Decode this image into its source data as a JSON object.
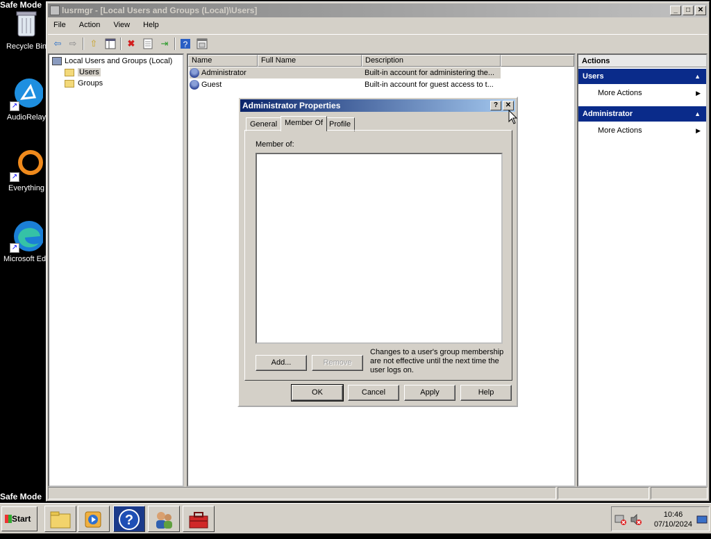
{
  "desktop": {
    "safe_mode_top": "Safe Mode",
    "safe_mode_bottom": "Safe Mode",
    "icons": [
      {
        "label": "Recycle Bin",
        "icon": "recycle-bin-icon"
      },
      {
        "label": "AudioRelay",
        "icon": "audiorelay-icon"
      },
      {
        "label": "Everything",
        "icon": "everything-icon"
      },
      {
        "label": "Microsoft Edge",
        "icon": "edge-icon"
      }
    ]
  },
  "window": {
    "title": "lusrmgr - [Local Users and Groups (Local)\\Users]",
    "controls": {
      "minimize": "_",
      "maximize": "□",
      "close": "✕"
    },
    "menu": [
      "File",
      "Action",
      "View",
      "Help"
    ],
    "toolbar_icons": [
      "back-icon",
      "forward-icon",
      "up-folder-icon",
      "show-hide-tree-icon",
      "delete-icon",
      "properties-icon",
      "export-list-icon",
      "help-icon",
      "console-icon"
    ]
  },
  "tree": {
    "root": "Local Users and Groups (Local)",
    "children": [
      {
        "label": "Users",
        "selected": true
      },
      {
        "label": "Groups",
        "selected": false
      }
    ]
  },
  "list": {
    "columns": [
      "Name",
      "Full Name",
      "Description"
    ],
    "rows": [
      {
        "name": "Administrator",
        "full_name": "",
        "description": "Built-in account for administering the..."
      },
      {
        "name": "Guest",
        "full_name": "",
        "description": "Built-in account for guest access to t..."
      }
    ]
  },
  "actions": {
    "title": "Actions",
    "sections": [
      {
        "title": "Users",
        "item": "More Actions"
      },
      {
        "title": "Administrator",
        "item": "More Actions"
      }
    ]
  },
  "dialog": {
    "title": "Administrator Properties",
    "help_btn": "?",
    "close_btn": "✕",
    "tabs": [
      "General",
      "Member Of",
      "Profile"
    ],
    "active_tab": "Member Of",
    "member_of_label": "Member of:",
    "add_label": "Add...",
    "remove_label": "Remove",
    "note_lines": [
      "Changes to a user's group membership",
      "are not effective until the next time the",
      "user logs on."
    ],
    "ok_label": "OK",
    "cancel_label": "Cancel",
    "apply_label": "Apply",
    "help_label": "Help"
  },
  "taskbar": {
    "start_label": "Start",
    "quick_launch": [
      "explorer-icon",
      "media-player-icon",
      "help-support-icon",
      "users-icon",
      "toolbox-icon"
    ],
    "time": "10:46",
    "date": "07/10/2024"
  }
}
